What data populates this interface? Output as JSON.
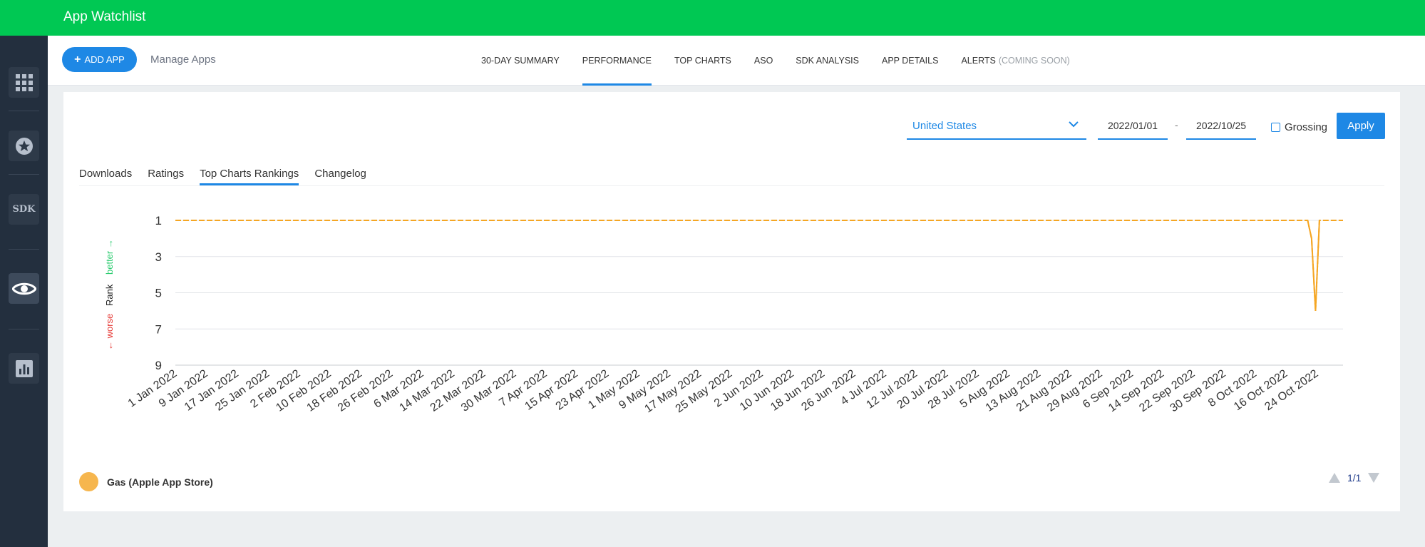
{
  "app": {
    "title": "App Watchlist"
  },
  "sidebar": {
    "items": [
      {
        "name": "apps-grid",
        "icon": "grid-icon",
        "active": false
      },
      {
        "name": "top-charts",
        "icon": "star-icon",
        "active": false
      },
      {
        "name": "sdk",
        "icon": "sdk-icon",
        "label": "SDK",
        "active": false
      },
      {
        "name": "watchlist",
        "icon": "eye-icon",
        "active": true
      },
      {
        "name": "reports",
        "icon": "bar-chart-icon",
        "active": false
      }
    ]
  },
  "navbar": {
    "add_app": "ADD APP",
    "manage_apps": "Manage Apps",
    "tabs": [
      {
        "label": "30-DAY SUMMARY"
      },
      {
        "label": "PERFORMANCE",
        "active": true
      },
      {
        "label": "TOP CHARTS"
      },
      {
        "label": "ASO"
      },
      {
        "label": "SDK ANALYSIS"
      },
      {
        "label": "APP DETAILS"
      },
      {
        "label": "ALERTS",
        "suffix": "(COMING SOON)"
      }
    ]
  },
  "filters": {
    "country": "United States",
    "start_date": "2022/01/01",
    "separator": "-",
    "end_date": "2022/10/25",
    "grossing_label": "Grossing",
    "grossing_checked": false,
    "apply": "Apply"
  },
  "subtabs": [
    {
      "label": "Downloads"
    },
    {
      "label": "Ratings"
    },
    {
      "label": "Top Charts Rankings",
      "active": true
    },
    {
      "label": "Changelog"
    }
  ],
  "chart_data": {
    "type": "line",
    "ylabel": {
      "worse": "← worse",
      "middle": "Rank",
      "better": "better →"
    },
    "ylim": [
      9,
      1
    ],
    "y_inverted": true,
    "yticks": [
      1,
      3,
      5,
      7,
      9
    ],
    "xticks": [
      "1 Jan 2022",
      "9 Jan 2022",
      "17 Jan 2022",
      "25 Jan 2022",
      "2 Feb 2022",
      "10 Feb 2022",
      "18 Feb 2022",
      "26 Feb 2022",
      "6 Mar 2022",
      "14 Mar 2022",
      "22 Mar 2022",
      "30 Mar 2022",
      "7 Apr 2022",
      "15 Apr 2022",
      "23 Apr 2022",
      "1 May 2022",
      "9 May 2022",
      "17 May 2022",
      "25 May 2022",
      "2 Jun 2022",
      "10 Jun 2022",
      "18 Jun 2022",
      "26 Jun 2022",
      "4 Jul 2022",
      "12 Jul 2022",
      "20 Jul 2022",
      "28 Jul 2022",
      "5 Aug 2022",
      "13 Aug 2022",
      "21 Aug 2022",
      "29 Aug 2022",
      "6 Sep 2022",
      "14 Sep 2022",
      "22 Sep 2022",
      "30 Sep 2022",
      "8 Oct 2022",
      "16 Oct 2022",
      "24 Oct 2022"
    ],
    "x_start": "2022-01-01",
    "x_end": "2022-10-25",
    "grid": true,
    "series": [
      {
        "name": "Gas (Apple App Store)",
        "color": "#f5a623",
        "points": [
          {
            "date": "2022-01-01",
            "rank": 1
          },
          {
            "date": "2022-10-16",
            "rank": 1
          },
          {
            "date": "2022-10-17",
            "rank": 2
          },
          {
            "date": "2022-10-18",
            "rank": 6
          },
          {
            "date": "2022-10-19",
            "rank": 1
          },
          {
            "date": "2022-10-25",
            "rank": 1
          }
        ]
      }
    ]
  },
  "legend": {
    "dot_color": "#f6b64e",
    "label": "Gas (Apple App Store)"
  },
  "pager": {
    "text": "1/1"
  }
}
